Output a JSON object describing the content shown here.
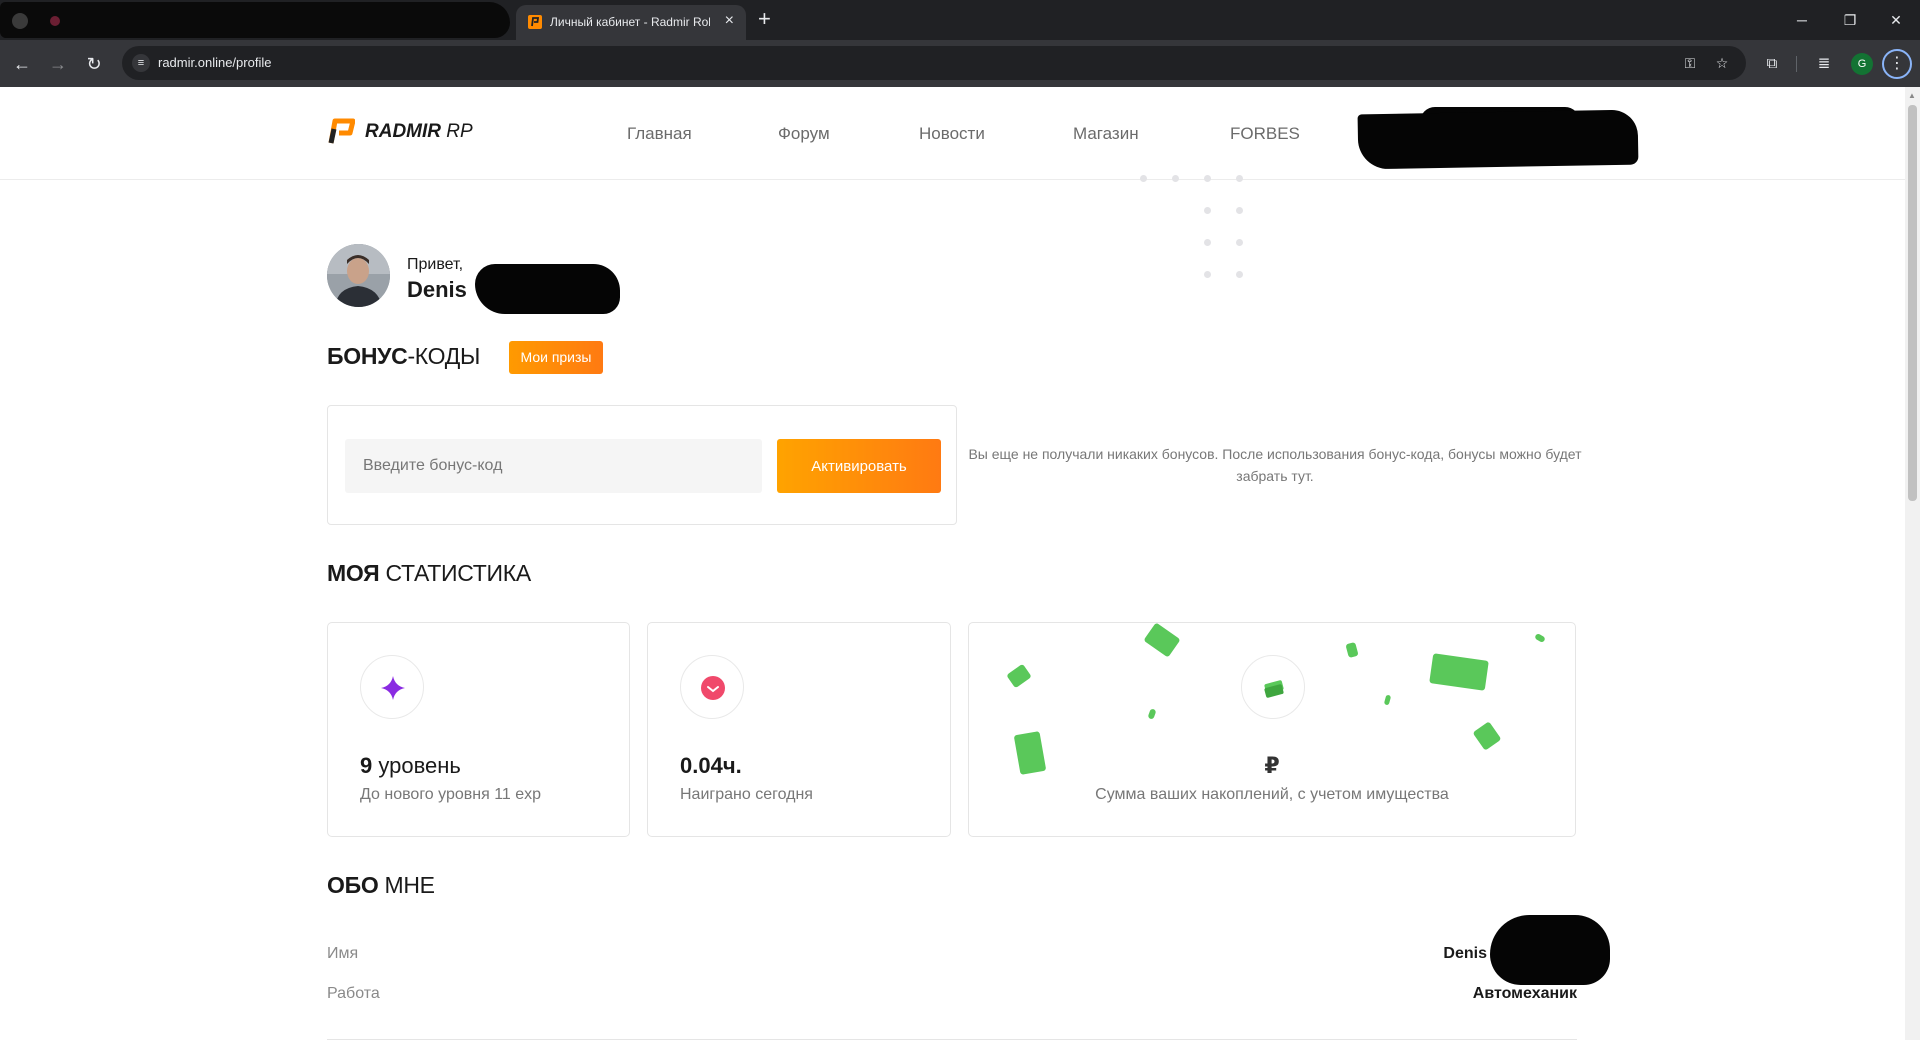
{
  "browser": {
    "active_tab_title": "Личный кабинет - Radmir Role",
    "url": "radmir.online/profile",
    "profile_initial": "G"
  },
  "site": {
    "logo_text": "RADMIR",
    "logo_suffix": "RP",
    "accent_color": "#ff8a00",
    "nav": [
      {
        "label": "Главная"
      },
      {
        "label": "Форум"
      },
      {
        "label": "Новости"
      },
      {
        "label": "Магазин"
      },
      {
        "label": "FORBES"
      }
    ]
  },
  "greeting": {
    "hello": "Привет,",
    "name": "Denis"
  },
  "bonus": {
    "title_bold": "БОНУС",
    "title_rest": "-КОДЫ",
    "prizes_label": "Мои призы",
    "input_placeholder": "Введите бонус-код",
    "activate_label": "Активировать",
    "empty_text": "Вы еще не получали никаких бонусов. После использования бонус-кода, бонусы можно будет забрать тут."
  },
  "stats": {
    "title_bold": "МОЯ",
    "title_rest": " СТАТИСТИКА",
    "level": {
      "value": "9",
      "unit": " уровень",
      "caption": "До нового уровня 11 exp",
      "icon": "sparkle-icon"
    },
    "playtime": {
      "value": "0.04ч.",
      "caption": "Наиграно сегодня",
      "icon": "clock-icon"
    },
    "money": {
      "value": "₽",
      "caption": "Сумма ваших накоплений, с учетом имущества",
      "icon": "money-icon"
    }
  },
  "about": {
    "title_bold": "ОБО",
    "title_rest": " МНЕ",
    "rows": [
      {
        "label": "Имя",
        "value": "Denis"
      },
      {
        "label": "Работа",
        "value": "Автомеханик"
      }
    ]
  }
}
